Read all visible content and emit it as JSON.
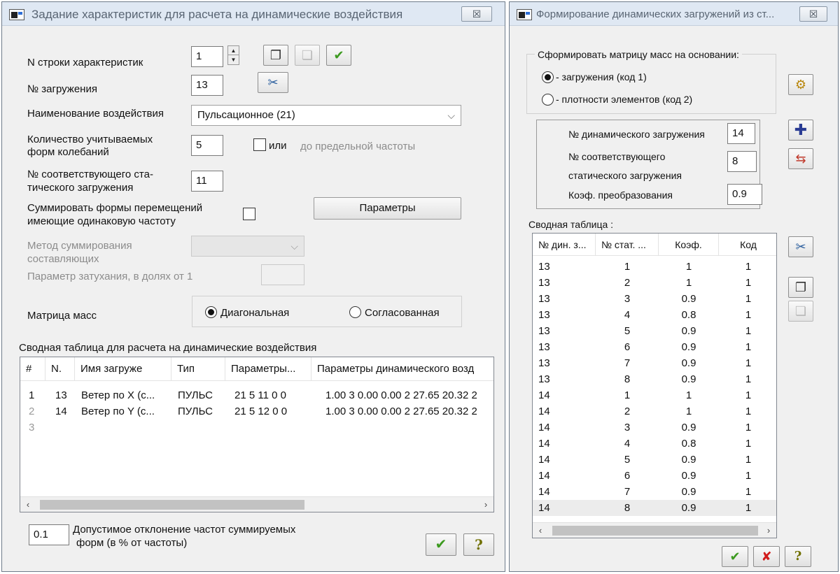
{
  "left": {
    "title": "Задание характеристик для расчета на динамические воздействия",
    "close_glyph": "☒",
    "row_label": "N строки характеристик",
    "row_value": "1",
    "load_label": "№ загружения",
    "load_value": "13",
    "action_label": "Наименование воздействия",
    "action_value": "Пульсационное (21)",
    "modes_label_1": "Количество учитываемых",
    "modes_label_2": "форм колебаний",
    "modes_value": "5",
    "or_label": "или",
    "freq_label": "до предельной частоты",
    "static_label_1": "№ соответствующего ста-",
    "static_label_2": "тического загружения",
    "static_value": "11",
    "sum_label_1": "Суммировать формы перемещений",
    "sum_label_2": "имеющие одинаковую частоту",
    "params_button": "Параметры",
    "method_label_1": "Метод суммирования",
    "method_label_2": "составляющих",
    "damping_label": "Параметр затухания, в долях от 1",
    "mass_label": "Матрица масс",
    "mass_diag": "Диагональная",
    "mass_consistent": "Согласованная",
    "table_title": "Сводная таблица для расчета на динамические воздействия",
    "columns": [
      "#",
      "N.",
      "Имя загруже",
      "Тип",
      "Параметры...",
      "Параметры динамического возд"
    ],
    "rows": [
      {
        "idx": "1",
        "n": "13",
        "name": "Ветер по X (с...",
        "type": "ПУЛЬС",
        "p": "21  5 11 0  0",
        "dyn": "1.00 3 0.00 0.00 2 27.65 20.32 2"
      },
      {
        "idx": "2",
        "n": "14",
        "name": "Ветер по Y (с...",
        "type": "ПУЛЬС",
        "p": "21  5 12 0  0",
        "dyn": "1.00 3 0.00 0.00 2 27.65 20.32 2"
      },
      {
        "idx": "3",
        "n": "",
        "name": "",
        "type": "",
        "p": "",
        "dyn": ""
      }
    ],
    "tolerance_value": "0.1",
    "tolerance_label_1": "Допустимое отклонение частот суммируемых",
    "tolerance_label_2": "форм (в % от частоты)",
    "ok_glyph": "✔",
    "help_glyph": "?"
  },
  "right": {
    "title": "Формирование динамических загружений из ст...",
    "close_glyph": "☒",
    "group_title": "Сформировать матрицу масс на основании:",
    "opt1": "- загружения (код 1)",
    "opt2": "- плотности элементов (код 2)",
    "dyn_label": "№  динамического загружения",
    "dyn_value": "14",
    "stat_label_1": "№ соответствующего",
    "stat_label_2": "статического загружения",
    "stat_value": "8",
    "coef_label": "Коэф. преобразования",
    "coef_value": "0.9",
    "summary_title": "Сводная таблица :",
    "columns": [
      "№ дин. з...",
      "№ стат. ...",
      "Коэф.",
      "Код"
    ],
    "rows": [
      [
        "13",
        "1",
        "1",
        "1"
      ],
      [
        "13",
        "2",
        "1",
        "1"
      ],
      [
        "13",
        "3",
        "0.9",
        "1"
      ],
      [
        "13",
        "4",
        "0.8",
        "1"
      ],
      [
        "13",
        "5",
        "0.9",
        "1"
      ],
      [
        "13",
        "6",
        "0.9",
        "1"
      ],
      [
        "13",
        "7",
        "0.9",
        "1"
      ],
      [
        "13",
        "8",
        "0.9",
        "1"
      ],
      [
        "14",
        "1",
        "1",
        "1"
      ],
      [
        "14",
        "2",
        "1",
        "1"
      ],
      [
        "14",
        "3",
        "0.9",
        "1"
      ],
      [
        "14",
        "4",
        "0.8",
        "1"
      ],
      [
        "14",
        "5",
        "0.9",
        "1"
      ],
      [
        "14",
        "6",
        "0.9",
        "1"
      ],
      [
        "14",
        "7",
        "0.9",
        "1"
      ],
      [
        "14",
        "8",
        "0.9",
        "1"
      ]
    ],
    "ok_glyph": "✔",
    "cancel_glyph": "✘",
    "help_glyph": "?"
  },
  "colors": {
    "titlebar": "#dfe8f3",
    "window": "#f0f0f0",
    "ok": "#3c9a1f",
    "cancel": "#d11a1a"
  }
}
